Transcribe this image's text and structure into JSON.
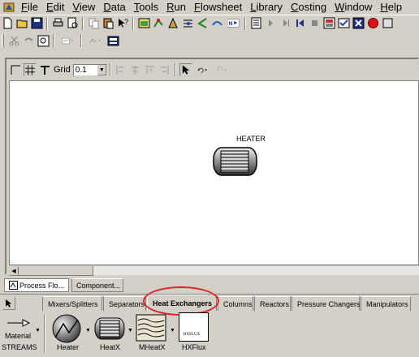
{
  "menubar": {
    "items": [
      {
        "label": "File",
        "accel": "F",
        "rest": "ile"
      },
      {
        "label": "Edit",
        "accel": "E",
        "rest": "dit"
      },
      {
        "label": "View",
        "accel": "V",
        "rest": "iew"
      },
      {
        "label": "Data",
        "accel": "D",
        "rest": "ata"
      },
      {
        "label": "Tools",
        "accel": "T",
        "rest": "ools"
      },
      {
        "label": "Run",
        "accel": "R",
        "rest": "un"
      },
      {
        "label": "Flowsheet",
        "accel": "F",
        "rest": "lowsheet"
      },
      {
        "label": "Library",
        "accel": "L",
        "rest": "ibrary"
      },
      {
        "label": "Costing",
        "accel": "C",
        "rest": "osting"
      },
      {
        "label": "Window",
        "accel": "W",
        "rest": "indow"
      },
      {
        "label": "Help",
        "accel": "H",
        "rest": "elp"
      }
    ]
  },
  "flowsheet_toolbar": {
    "grid_label": "Grid",
    "grid_value": "0.1"
  },
  "canvas": {
    "block_label": "HEATER"
  },
  "window_tabs": [
    {
      "label": "Process Flo...",
      "active": true
    },
    {
      "label": "Component...",
      "active": false
    }
  ],
  "palette": {
    "tabs": [
      {
        "label": "Mixers/Splitters"
      },
      {
        "label": "Separators"
      },
      {
        "label": "Heat Exchangers"
      },
      {
        "label": "Columns"
      },
      {
        "label": "Reactors"
      },
      {
        "label": "Pressure Changers"
      },
      {
        "label": "Manipulators"
      }
    ],
    "active_tab": "Heat Exchangers",
    "items": {
      "material_label": "Material",
      "streams_label": "STREAMS",
      "heater_label": "Heater",
      "heatx_label": "HeatX",
      "mheatx_label": "MHeatX",
      "hxflux_label": "HXFlux",
      "hxflux_icon_text": "HXFLUX"
    }
  },
  "colors": {
    "highlight_circle": "#d9252a",
    "window_bg": "#d4d0c8",
    "canvas_bg": "#ffffff"
  }
}
